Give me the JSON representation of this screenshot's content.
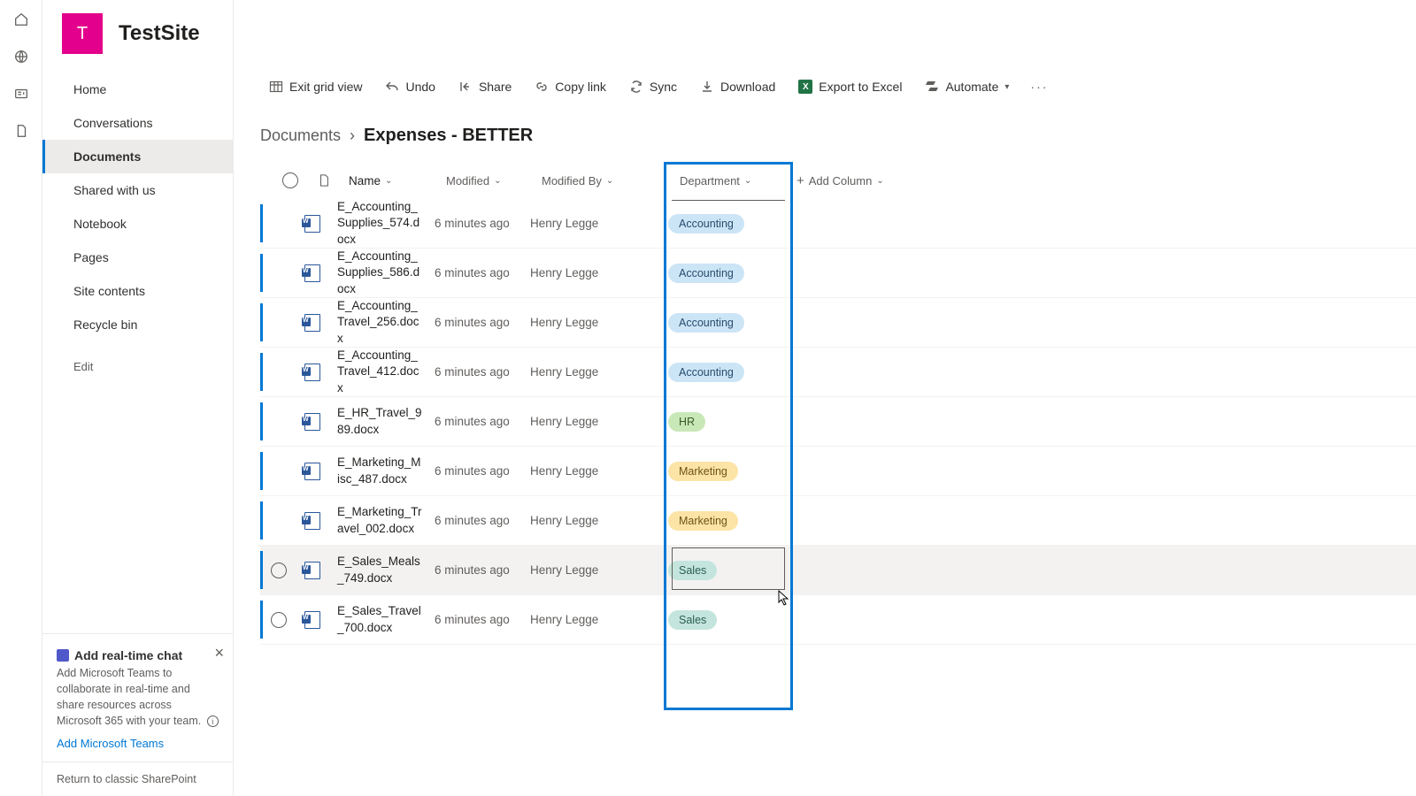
{
  "site": {
    "logo_letter": "T",
    "title": "TestSite"
  },
  "nav": {
    "items": [
      "Home",
      "Conversations",
      "Documents",
      "Shared with us",
      "Notebook",
      "Pages",
      "Site contents",
      "Recycle bin"
    ],
    "edit": "Edit",
    "active_index": 2
  },
  "promo": {
    "title": "Add real-time chat",
    "body": "Add Microsoft Teams to collaborate in real-time and share resources across Microsoft 365 with your team.",
    "link": "Add Microsoft Teams"
  },
  "classic_link": "Return to classic SharePoint",
  "commands": {
    "exit": "Exit grid view",
    "undo": "Undo",
    "share": "Share",
    "copy": "Copy link",
    "sync": "Sync",
    "download": "Download",
    "export": "Export to Excel",
    "automate": "Automate"
  },
  "breadcrumb": {
    "root": "Documents",
    "current": "Expenses - BETTER"
  },
  "columns": {
    "name": "Name",
    "modified": "Modified",
    "by": "Modified By",
    "dept": "Department",
    "add": "Add Column"
  },
  "rows": [
    {
      "name": "E_Accounting_Supplies_574.docx",
      "mod": "6 minutes ago",
      "by": "Henry Legge",
      "dept": "Accounting",
      "cls": "p-accounting"
    },
    {
      "name": "E_Accounting_Supplies_586.docx",
      "mod": "6 minutes ago",
      "by": "Henry Legge",
      "dept": "Accounting",
      "cls": "p-accounting"
    },
    {
      "name": "E_Accounting_Travel_256.docx",
      "mod": "6 minutes ago",
      "by": "Henry Legge",
      "dept": "Accounting",
      "cls": "p-accounting"
    },
    {
      "name": "E_Accounting_Travel_412.docx",
      "mod": "6 minutes ago",
      "by": "Henry Legge",
      "dept": "Accounting",
      "cls": "p-accounting"
    },
    {
      "name": "E_HR_Travel_989.docx",
      "mod": "6 minutes ago",
      "by": "Henry Legge",
      "dept": "HR",
      "cls": "p-hr"
    },
    {
      "name": "E_Marketing_Misc_487.docx",
      "mod": "6 minutes ago",
      "by": "Henry Legge",
      "dept": "Marketing",
      "cls": "p-marketing"
    },
    {
      "name": "E_Marketing_Travel_002.docx",
      "mod": "6 minutes ago",
      "by": "Henry Legge",
      "dept": "Marketing",
      "cls": "p-marketing"
    },
    {
      "name": "E_Sales_Meals_749.docx",
      "mod": "6 minutes ago",
      "by": "Henry Legge",
      "dept": "Sales",
      "cls": "p-sales",
      "sel": true,
      "circ": true
    },
    {
      "name": "E_Sales_Travel_700.docx",
      "mod": "6 minutes ago",
      "by": "Henry Legge",
      "dept": "Sales",
      "cls": "p-sales",
      "circ": true
    }
  ]
}
